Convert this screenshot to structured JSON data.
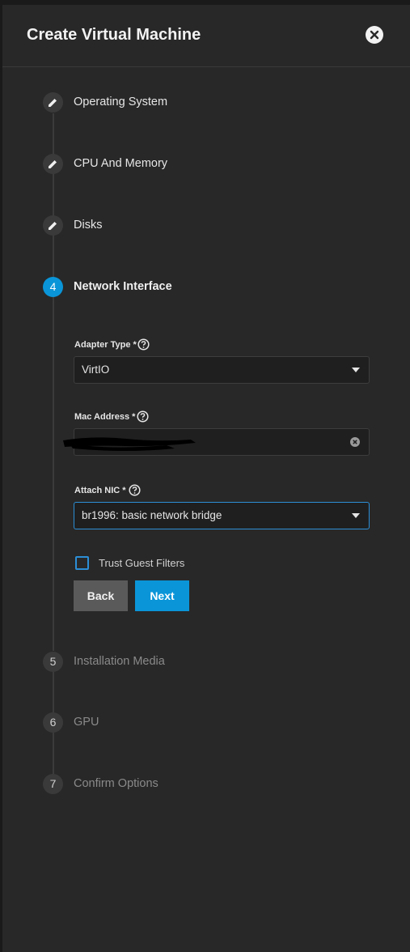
{
  "dialog": {
    "title": "Create Virtual Machine",
    "close_icon": "close-circle-icon"
  },
  "steps": [
    {
      "marker": "edit-icon",
      "label": "Operating System",
      "state": "completed"
    },
    {
      "marker": "edit-icon",
      "label": "CPU And Memory",
      "state": "completed"
    },
    {
      "marker": "edit-icon",
      "label": "Disks",
      "state": "completed"
    },
    {
      "marker": "4",
      "label": "Network Interface",
      "state": "active"
    },
    {
      "marker": "5",
      "label": "Installation Media",
      "state": "pending"
    },
    {
      "marker": "6",
      "label": "GPU",
      "state": "pending"
    },
    {
      "marker": "7",
      "label": "Confirm Options",
      "state": "pending"
    }
  ],
  "form": {
    "adapter_type": {
      "label": "Adapter Type",
      "required_mark": "*",
      "value": "VirtIO"
    },
    "mac_address": {
      "label": "Mac Address",
      "required_mark": "*",
      "value": ""
    },
    "attach_nic": {
      "label": "Attach NIC",
      "required_mark": "*",
      "value": "br1996: basic network bridge"
    },
    "trust_guest_filters": {
      "label": "Trust Guest Filters",
      "checked": false
    }
  },
  "buttons": {
    "back": "Back",
    "next": "Next"
  },
  "colors": {
    "accent": "#0a95d8",
    "background": "#282828"
  }
}
